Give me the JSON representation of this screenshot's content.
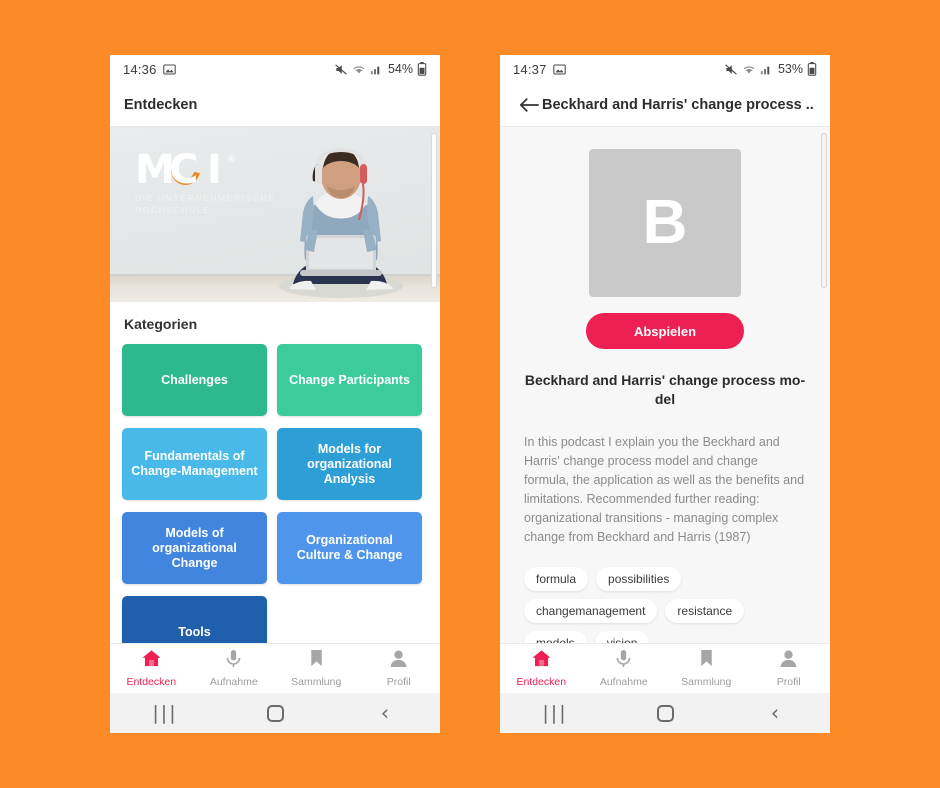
{
  "background_color": "#FC8A26",
  "accent_color": "#EE1F52",
  "phones": {
    "left": {
      "status": {
        "time": "14:36",
        "battery_percent": "54%",
        "icons": [
          "image-icon",
          "mute-icon",
          "wifi-icon",
          "signal-icon",
          "battery-icon"
        ]
      },
      "appbar": {
        "title": "Entdecken"
      },
      "hero": {
        "logo_letters": {
          "m": "M",
          "c": "C",
          "i": "I",
          "registered": "®"
        },
        "logo_subtitle_line1": "DIE UNTERNEHMERISCHE",
        "logo_subtitle_line2": "HOCHSCHULE"
      },
      "categories_heading": "Kategorien",
      "tiles": [
        {
          "label": "Challenges",
          "color": "#2EB88E"
        },
        {
          "label": "Change Participants",
          "color": "#3CCC9C"
        },
        {
          "label": "Fundamentals of Change-Management",
          "color": "#48B9E8"
        },
        {
          "label": "Models for organizational Analysis",
          "color": "#2E9FD6"
        },
        {
          "label": "Models of organizational Change",
          "color": "#4285DE"
        },
        {
          "label": "Organizational Culture & Change",
          "color": "#4E95EB"
        },
        {
          "label": "Tools",
          "color": "#1F5FAC"
        }
      ]
    },
    "right": {
      "status": {
        "time": "14:37",
        "battery_percent": "53%",
        "icons": [
          "image-icon",
          "mute-icon",
          "wifi-icon",
          "signal-icon",
          "battery-icon"
        ]
      },
      "appbar": {
        "title": "Beckhard and Harris' change process ...",
        "back_icon": "back-arrow-icon"
      },
      "detail": {
        "thumbnail_letter": "B",
        "play_label": "Abspielen",
        "title": "Beckhard and Harris' change process mo-del",
        "description": "In this podcast I explain you the Beckhard and Harris' change process model and change formula, the application as well as the benefits and limitations. Recommended further reading: organizational transitions - managing complex change from Beckhard and Harris (1987)",
        "tags": [
          "formula",
          "possibilities",
          "changemanagement",
          "resistance",
          "models",
          "vision"
        ]
      }
    }
  },
  "bottom_nav": {
    "items": [
      {
        "label": "Entdecken",
        "icon": "home-icon",
        "active": true
      },
      {
        "label": "Aufnahme",
        "icon": "microphone-icon",
        "active": false
      },
      {
        "label": "Sammlung",
        "icon": "bookmark-icon",
        "active": false
      },
      {
        "label": "Profil",
        "icon": "person-icon",
        "active": false
      }
    ]
  },
  "system_bar": {
    "recents": "|||",
    "home": "home-square-icon",
    "back": "‹"
  }
}
